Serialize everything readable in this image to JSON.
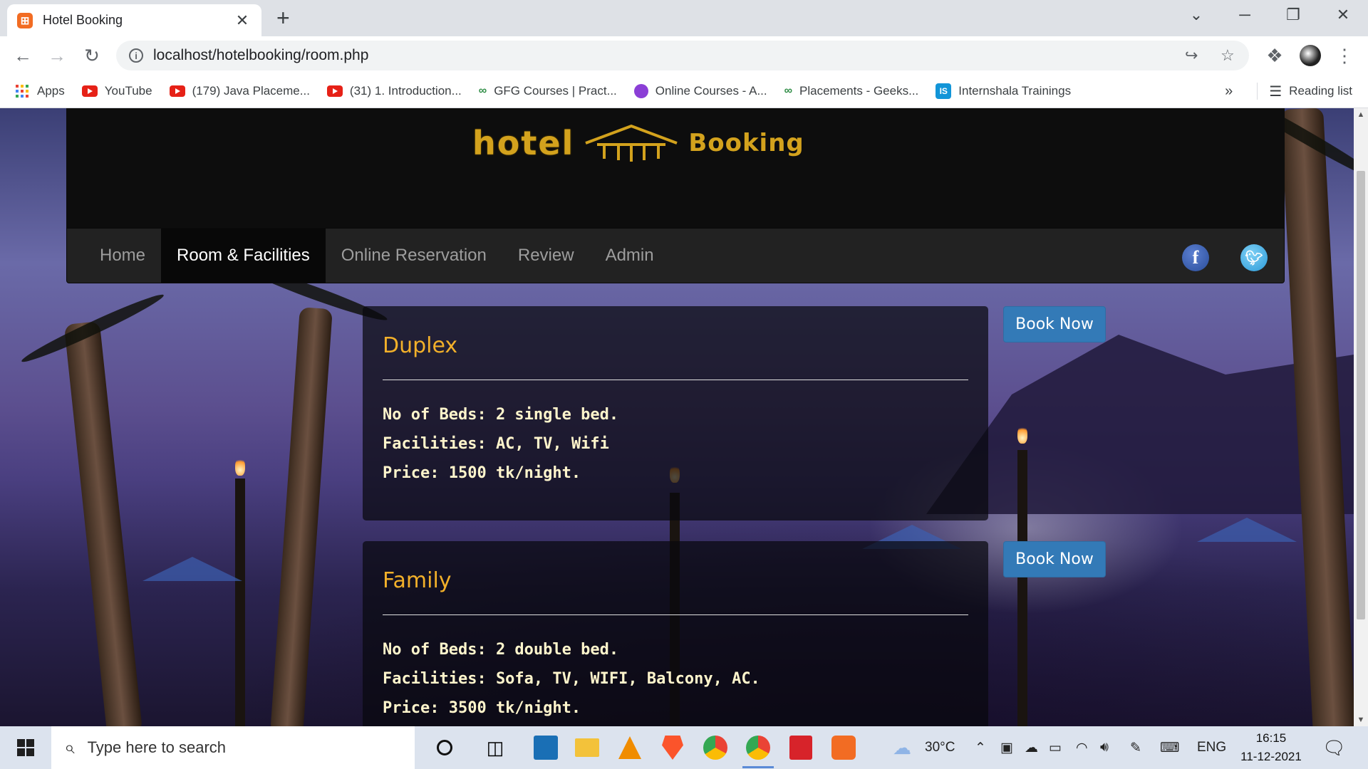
{
  "browser": {
    "tab_title": "Hotel Booking",
    "favicon_glyph": "⊞",
    "url": "localhost/hotelbooking/room.php",
    "bookmarks": [
      {
        "label": "Apps",
        "icon": "apps-grid-icon"
      },
      {
        "label": "YouTube",
        "icon": "youtube-icon"
      },
      {
        "label": "(179) Java Placeme...",
        "icon": "youtube-icon"
      },
      {
        "label": "(31) 1. Introduction...",
        "icon": "youtube-icon"
      },
      {
        "label": "GFG Courses | Pract...",
        "icon": "gfg-icon"
      },
      {
        "label": "Online Courses - A...",
        "icon": "online-courses-icon"
      },
      {
        "label": "Placements - Geeks...",
        "icon": "gfg-icon"
      },
      {
        "label": "Internshala Trainings",
        "icon": "internshala-icon"
      }
    ],
    "overflow": "»",
    "reading_list": "Reading list"
  },
  "site": {
    "nav": [
      {
        "label": "Home",
        "active": false
      },
      {
        "label": "Room & Facilities",
        "active": true
      },
      {
        "label": "Online Reservation",
        "active": false
      },
      {
        "label": "Review",
        "active": false
      },
      {
        "label": "Admin",
        "active": false
      }
    ],
    "logo": {
      "left": "hotel",
      "right": "Booking"
    },
    "rooms": [
      {
        "name": "Duplex",
        "beds": "No of Beds: 2 single bed.",
        "facilities": "Facilities: AC, TV, Wifi",
        "price": "Price: 1500 tk/night.",
        "button": "Book Now"
      },
      {
        "name": "Family",
        "beds": "No of Beds: 2 double bed.",
        "facilities": "Facilities: Sofa, TV, WIFI, Balcony, AC.",
        "price": "Price: 3500 tk/night.",
        "button": "Book Now"
      }
    ],
    "colors": {
      "accent": "#f2b02a",
      "button": "#337ab7",
      "nav_bg": "#222222"
    }
  },
  "taskbar": {
    "search_placeholder": "Type here to search",
    "temperature": "30°C",
    "language": "ENG",
    "time": "16:15",
    "date": "11-12-2021"
  }
}
